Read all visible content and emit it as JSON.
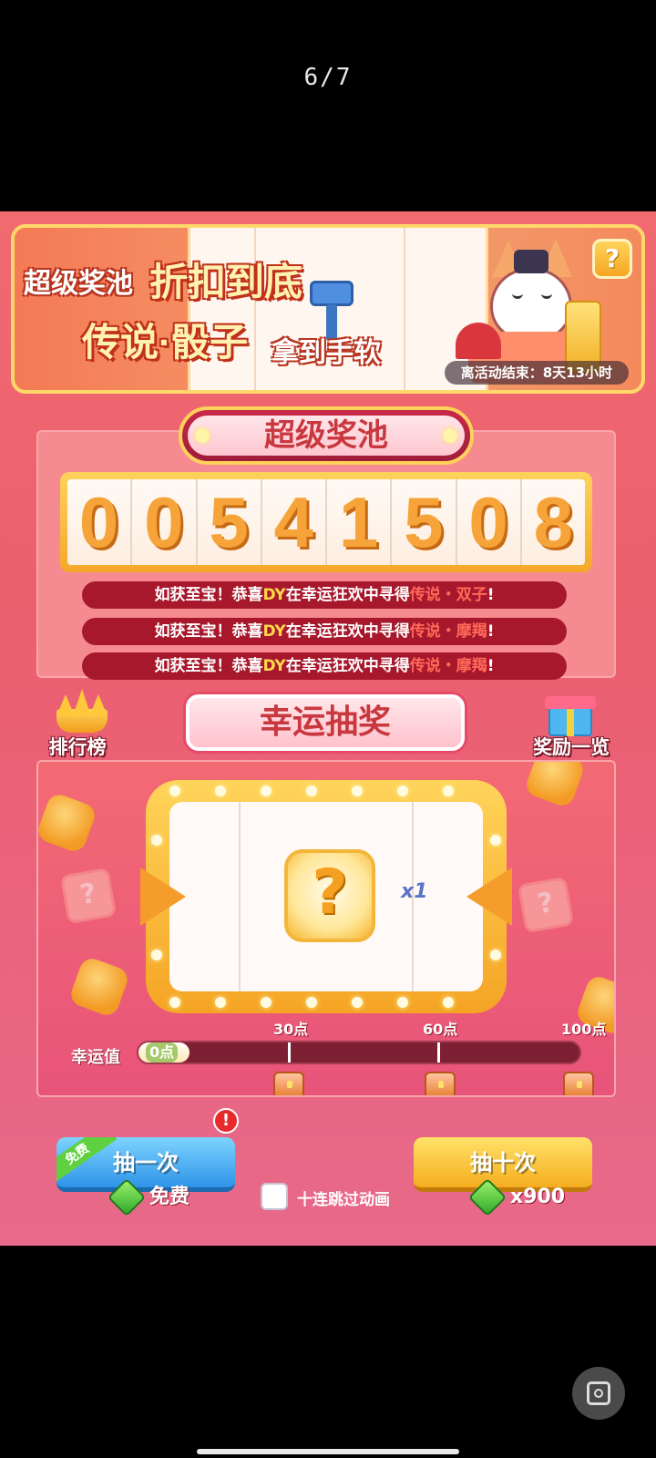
{
  "status": {
    "page_counter": "6/7"
  },
  "banner": {
    "line1": "超级奖池",
    "line2": "折扣到底",
    "line3": "传说·骰子",
    "line4": "拿到手软",
    "countdown": "离活动结束：8天13小时"
  },
  "jackpot": {
    "title": "超级奖池",
    "digits": [
      "0",
      "0",
      "5",
      "4",
      "1",
      "5",
      "0",
      "8"
    ],
    "ticker": [
      {
        "prefix": "如获至宝！恭喜",
        "name": "DY",
        "middle": "在幸运狂欢中寻得",
        "item": "传说・双子",
        "suffix": "!"
      },
      {
        "prefix": "如获至宝！恭喜",
        "name": "DY",
        "middle": "在幸运狂欢中寻得",
        "item": "传说・摩羯",
        "suffix": "!"
      },
      {
        "prefix": "如获至宝！恭喜",
        "name": "DY",
        "middle": "在幸运狂欢中寻得",
        "item": "传说・摩羯",
        "suffix": "!"
      }
    ]
  },
  "lucky_draw": {
    "leaderboard_label": "排行榜",
    "title": "幸运抽奖",
    "rewards_label": "奖励一览",
    "prize_multiplier": "x1",
    "luck_label": "幸运值",
    "luck_value": "0点",
    "luck_progress": 0,
    "milestones": [
      "30点",
      "60点",
      "100点"
    ]
  },
  "actions": {
    "draw_once_label": "抽一次",
    "free_tag": "免费",
    "badge": "!",
    "draw_ten_label": "抽十次",
    "once_cost": "免费",
    "skip_label": "十连跳过动画",
    "ten_cost": "x900"
  }
}
